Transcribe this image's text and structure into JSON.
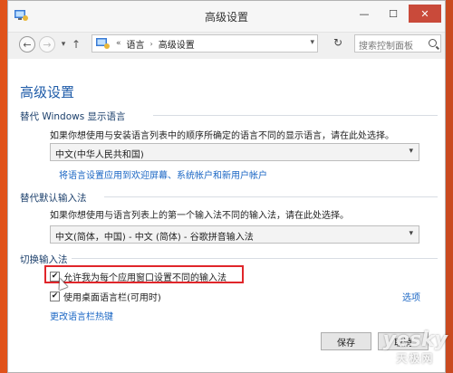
{
  "window": {
    "title": "高级设置",
    "controls": [
      "—",
      "☐",
      "✕"
    ]
  },
  "navigation": {
    "back": "←",
    "forward": "→",
    "recent": "▾",
    "up": "↑",
    "breadcrumb_sep": "«",
    "breadcrumb": [
      "语言",
      "高级设置"
    ],
    "dropdown": "▾",
    "refresh": "↻",
    "search_placeholder": "搜索控制面板"
  },
  "page": {
    "title": "高级设置",
    "display_language": {
      "heading": "替代 Windows 显示语言",
      "description": "如果你想使用与安装语言列表中的顺序所确定的语言不同的显示语言，请在此处选择。",
      "selected": "中文(中华人民共和国)",
      "link": "将语言设置应用到欢迎屏幕、系统帐户和新用户帐户"
    },
    "input_method": {
      "heading": "替代默认输入法",
      "description": "如果你想使用与语言列表上的第一个输入法不同的输入法，请在此处选择。",
      "selected": "中文(简体，中国) - 中文 (简体) - 谷歌拼音输入法"
    },
    "switch_input": {
      "heading": "切换输入法",
      "options": [
        {
          "label": "允许我为每个应用窗口设置不同的输入法",
          "checked": true
        },
        {
          "label": "使用桌面语言栏(可用时)",
          "checked": true
        }
      ],
      "options_link": "选项",
      "hotkeys_link": "更改语言栏热键"
    },
    "buttons": {
      "save": "保存",
      "cancel": "取消"
    }
  },
  "watermark": {
    "line1": "yesky",
    "line2": "天极网"
  },
  "colors": {
    "accent_blue": "#1e5ba8",
    "link_blue": "#1a66c4",
    "highlight_red": "#e0262a",
    "close_red": "#c94a3a"
  }
}
